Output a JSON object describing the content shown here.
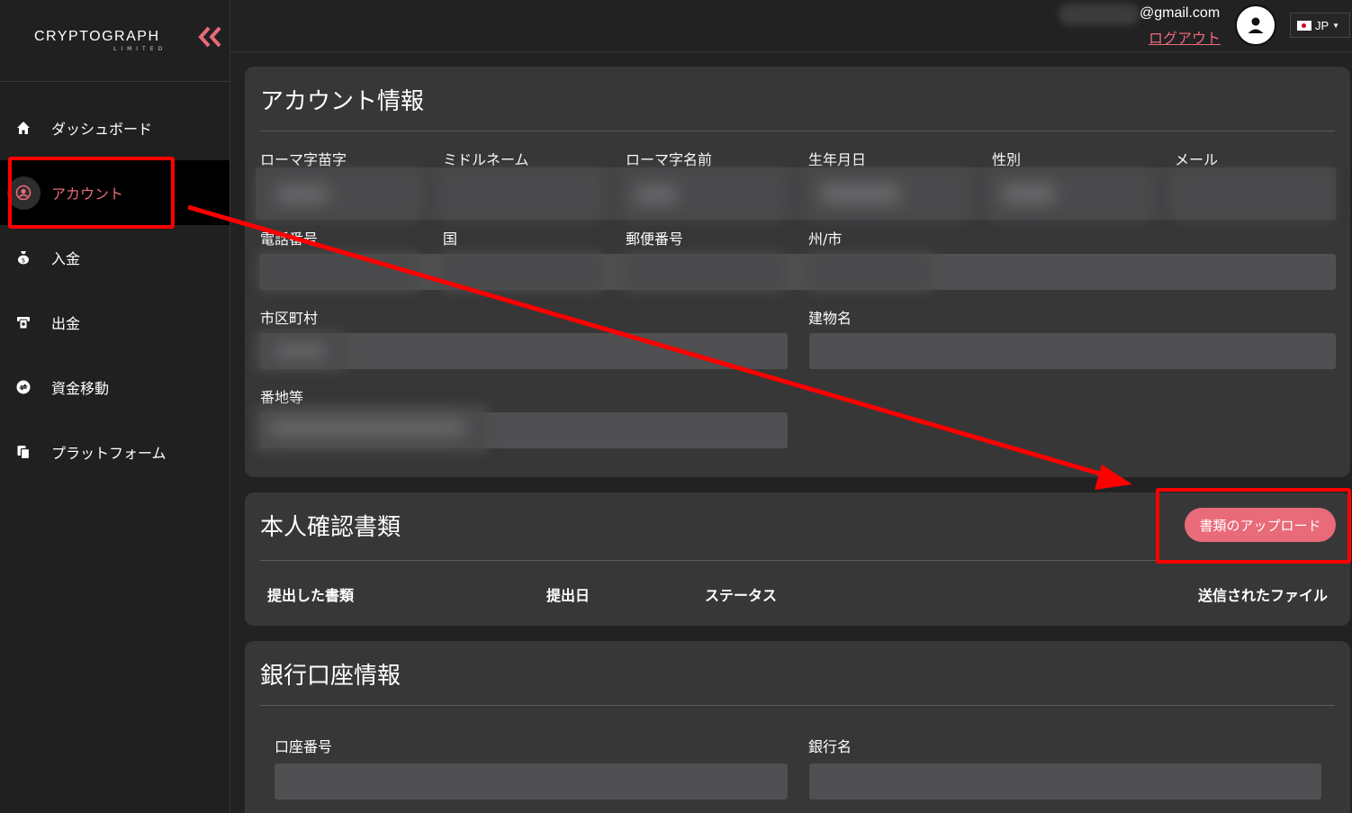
{
  "brand": {
    "name": "CRYPTOGRAPH",
    "sub": "LIMITED",
    "accent": "#e96a79"
  },
  "topbar": {
    "email": "@gmail.com",
    "logout": "ログアウト",
    "language": "JP",
    "avatar_icon": "user-icon"
  },
  "sidebar": {
    "items": [
      {
        "label": "ダッシュボード",
        "icon": "home-icon"
      },
      {
        "label": "アカウント",
        "icon": "account-icon",
        "active": true
      },
      {
        "label": "入金",
        "icon": "money-bag-icon"
      },
      {
        "label": "出金",
        "icon": "withdraw-icon"
      },
      {
        "label": "資金移動",
        "icon": "transfer-icon"
      },
      {
        "label": "プラットフォーム",
        "icon": "platform-icon"
      }
    ]
  },
  "account_info": {
    "title": "アカウント情報",
    "labels": {
      "last_name": "ローマ字苗字",
      "middle_name": "ミドルネーム",
      "first_name": "ローマ字名前",
      "birthdate": "生年月日",
      "gender": "性別",
      "email": "メール",
      "phone": "電話番号",
      "country": "国",
      "postal_code": "郵便番号",
      "state_city": "州/市",
      "municipality": "市区町村",
      "building": "建物名",
      "address": "番地等"
    }
  },
  "identity_docs": {
    "title": "本人確認書類",
    "upload_button": "書類のアップロード",
    "columns": [
      "提出した書類",
      "提出日",
      "ステータス",
      "送信されたファイル"
    ]
  },
  "bank_info": {
    "title": "銀行口座情報",
    "labels": {
      "account_number": "口座番号",
      "bank_name": "銀行名"
    }
  },
  "annotation": {
    "color": "#ff0000"
  }
}
